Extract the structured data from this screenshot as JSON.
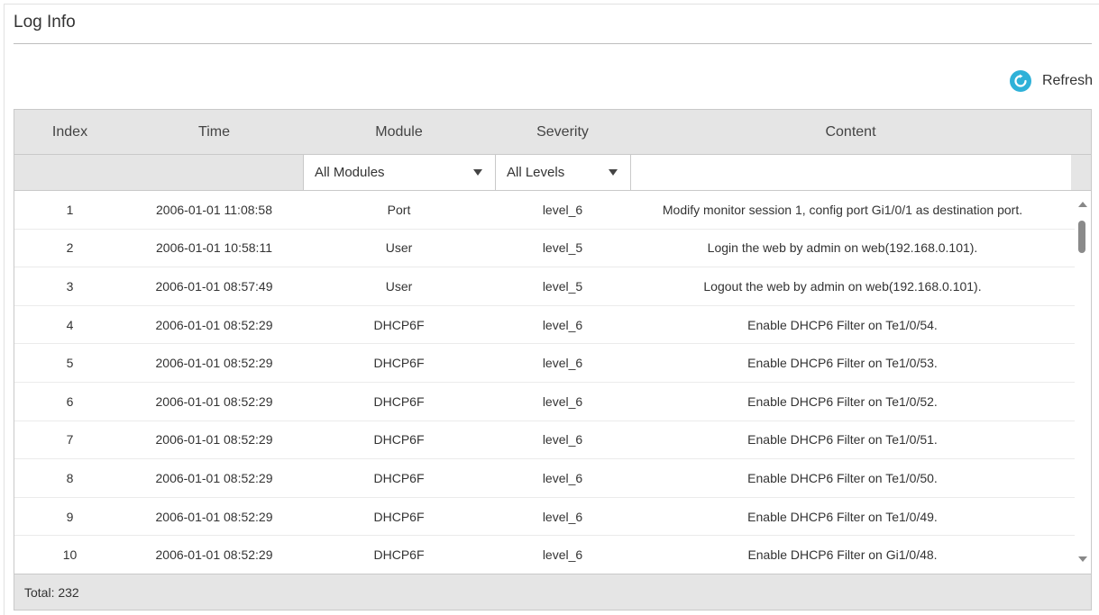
{
  "title": "Log Info",
  "refresh_label": "Refresh",
  "columns": [
    "Index",
    "Time",
    "Module",
    "Severity",
    "Content"
  ],
  "filters": {
    "module": "All Modules",
    "severity": "All Levels"
  },
  "rows": [
    {
      "index": "1",
      "time": "2006-01-01 11:08:58",
      "module": "Port",
      "severity": "level_6",
      "content": "Modify monitor session 1, config port Gi1/0/1 as destination port."
    },
    {
      "index": "2",
      "time": "2006-01-01 10:58:11",
      "module": "User",
      "severity": "level_5",
      "content": "Login the web by admin on web(192.168.0.101)."
    },
    {
      "index": "3",
      "time": "2006-01-01 08:57:49",
      "module": "User",
      "severity": "level_5",
      "content": "Logout the web by admin on web(192.168.0.101)."
    },
    {
      "index": "4",
      "time": "2006-01-01 08:52:29",
      "module": "DHCP6F",
      "severity": "level_6",
      "content": "Enable DHCP6 Filter on Te1/0/54."
    },
    {
      "index": "5",
      "time": "2006-01-01 08:52:29",
      "module": "DHCP6F",
      "severity": "level_6",
      "content": "Enable DHCP6 Filter on Te1/0/53."
    },
    {
      "index": "6",
      "time": "2006-01-01 08:52:29",
      "module": "DHCP6F",
      "severity": "level_6",
      "content": "Enable DHCP6 Filter on Te1/0/52."
    },
    {
      "index": "7",
      "time": "2006-01-01 08:52:29",
      "module": "DHCP6F",
      "severity": "level_6",
      "content": "Enable DHCP6 Filter on Te1/0/51."
    },
    {
      "index": "8",
      "time": "2006-01-01 08:52:29",
      "module": "DHCP6F",
      "severity": "level_6",
      "content": "Enable DHCP6 Filter on Te1/0/50."
    },
    {
      "index": "9",
      "time": "2006-01-01 08:52:29",
      "module": "DHCP6F",
      "severity": "level_6",
      "content": "Enable DHCP6 Filter on Te1/0/49."
    },
    {
      "index": "10",
      "time": "2006-01-01 08:52:29",
      "module": "DHCP6F",
      "severity": "level_6",
      "content": "Enable DHCP6 Filter on Gi1/0/48."
    }
  ],
  "footer": "Total: 232",
  "icons": {
    "refresh": "refresh-icon",
    "dropdown": "chevron-down-icon",
    "scroll_up": "arrow-up-icon",
    "scroll_down": "arrow-down-icon"
  },
  "colors": {
    "accent": "#2eb1d8",
    "header_bg": "#e5e5e5",
    "border": "#c9c9c9"
  }
}
